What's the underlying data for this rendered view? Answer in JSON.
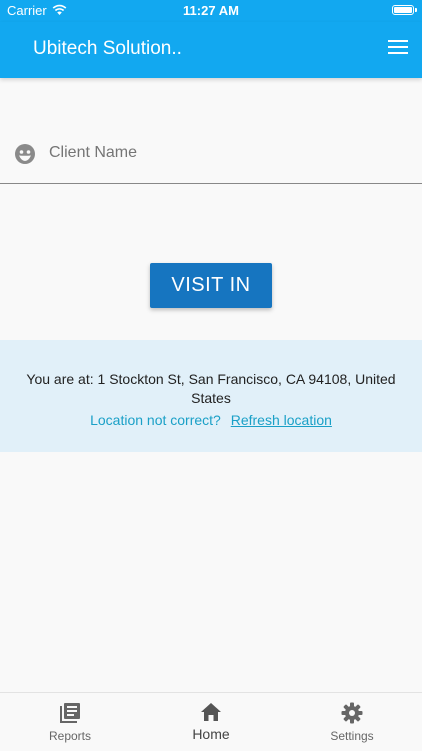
{
  "status_bar": {
    "carrier": "Carrier",
    "time": "11:27 AM"
  },
  "app_bar": {
    "title": "Ubitech Solution.."
  },
  "client_field": {
    "placeholder": "Client Name"
  },
  "visit_button": {
    "label": "VISIT IN"
  },
  "location": {
    "address": "You are at: 1 Stockton St, San Francisco, CA  94108, United States",
    "question": "Location not correct?",
    "refresh": "Refresh location"
  },
  "bottom_nav": {
    "items": [
      {
        "label": "Reports",
        "icon": "reports-icon"
      },
      {
        "label": "Home",
        "icon": "home-icon"
      },
      {
        "label": "Settings",
        "icon": "settings-icon"
      }
    ],
    "active": "Home"
  },
  "colors": {
    "primary": "#12a8f0",
    "button": "#1675c0",
    "panel": "#e1f0f9",
    "link": "#1aa0c7"
  }
}
